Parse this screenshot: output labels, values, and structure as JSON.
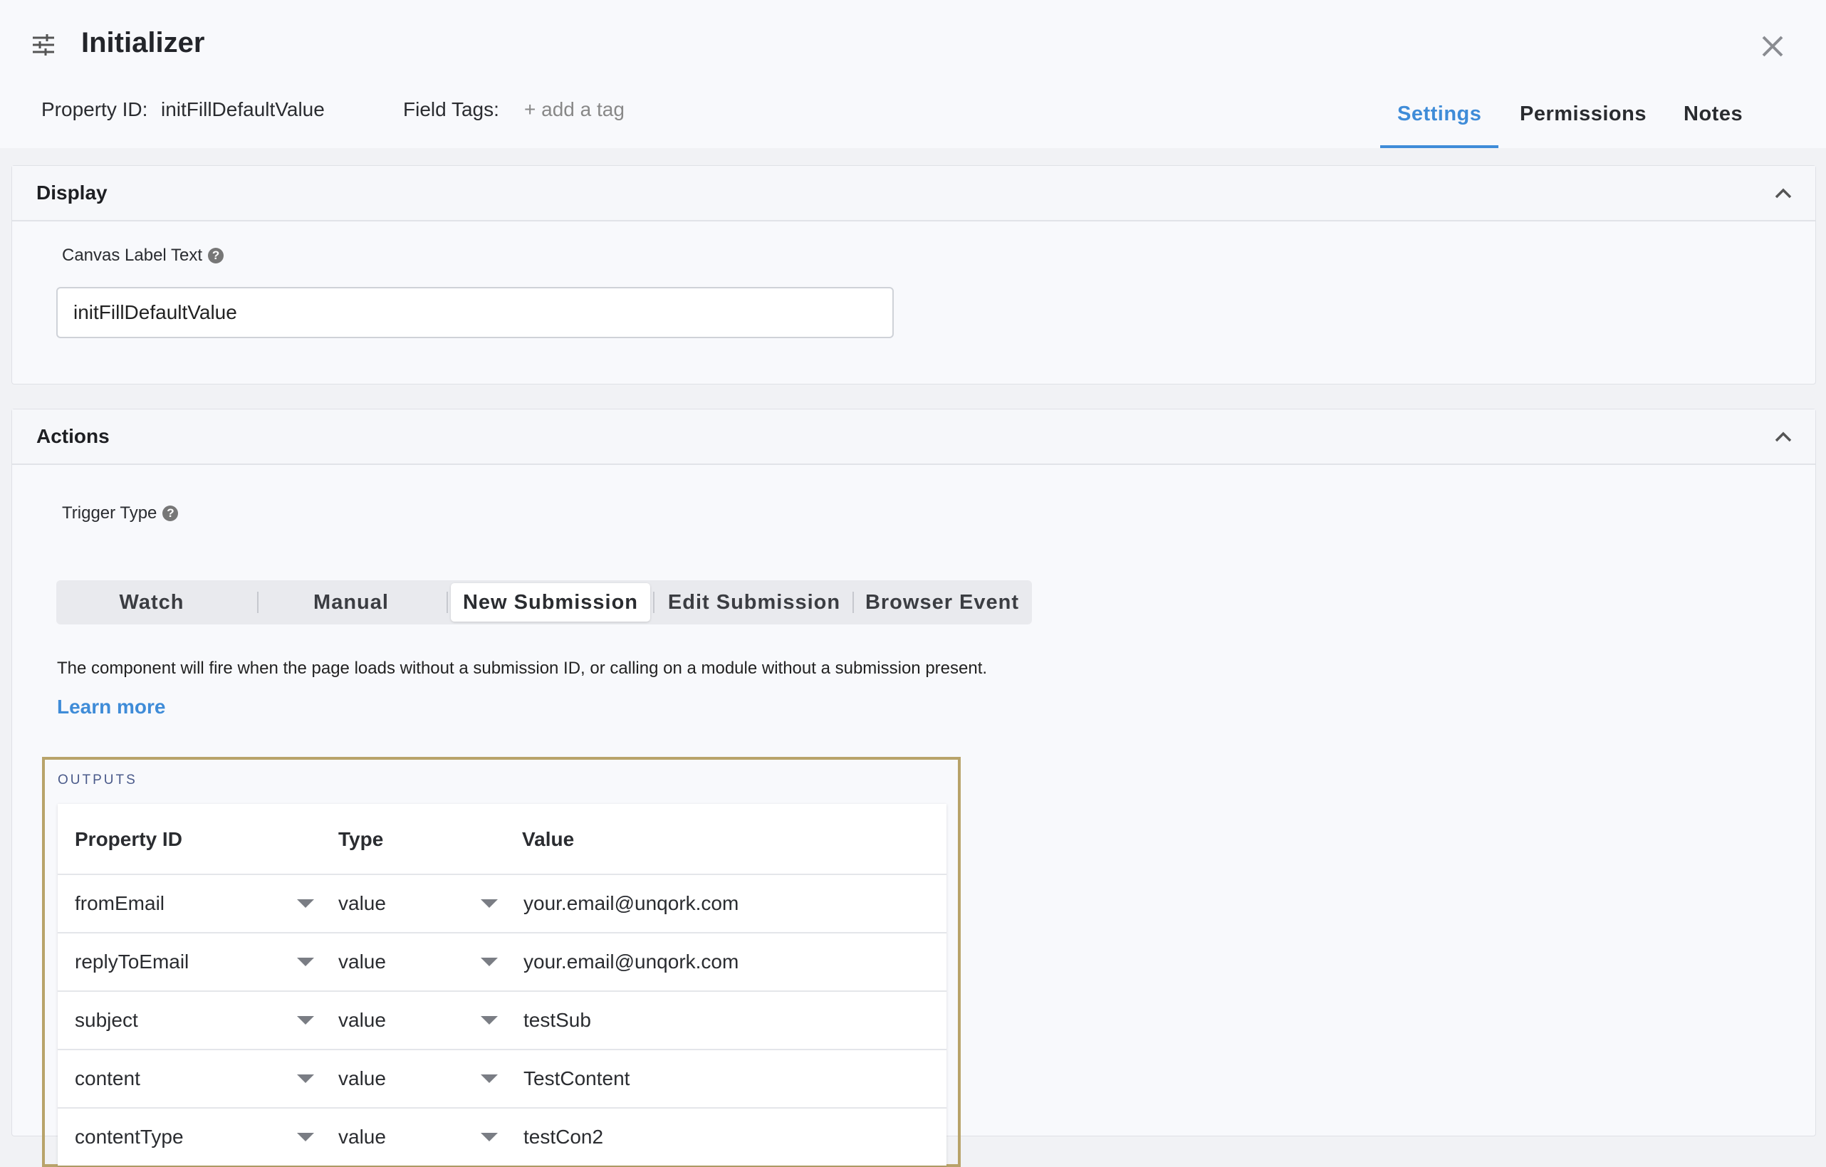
{
  "header": {
    "title": "Initializer",
    "property_id_label": "Property ID:",
    "property_id_value": "initFillDefaultValue",
    "field_tags_label": "Field Tags:",
    "add_tag_label": "+ add a tag",
    "tabs": [
      {
        "label": "Settings",
        "active": true
      },
      {
        "label": "Permissions",
        "active": false
      },
      {
        "label": "Notes",
        "active": false
      }
    ]
  },
  "display": {
    "section_title": "Display",
    "canvas_label_caption": "Canvas Label Text",
    "canvas_label_value": "initFillDefaultValue"
  },
  "actions": {
    "section_title": "Actions",
    "trigger_type_caption": "Trigger Type",
    "trigger_options": [
      "Watch",
      "Manual",
      "New Submission",
      "Edit Submission",
      "Browser Event"
    ],
    "selected_trigger": "New Submission",
    "description": "The component will fire when the page loads without a submission ID, or calling on a module without a submission present.",
    "learn_more": "Learn more",
    "outputs": {
      "label": "OUTPUTS",
      "columns": [
        "Property ID",
        "Type",
        "Value"
      ],
      "rows": [
        {
          "property_id": "fromEmail",
          "type": "value",
          "value": "your.email@unqork.com"
        },
        {
          "property_id": "replyToEmail",
          "type": "value",
          "value": "your.email@unqork.com"
        },
        {
          "property_id": "subject",
          "type": "value",
          "value": "testSub"
        },
        {
          "property_id": "content",
          "type": "value",
          "value": "TestContent"
        },
        {
          "property_id": "contentType",
          "type": "value",
          "value": "testCon2"
        }
      ]
    }
  },
  "colors": {
    "accent": "#3f8cd8",
    "highlight_border": "#b8a36a"
  },
  "icons": {
    "menu": "sliders-icon",
    "close": "close-icon",
    "collapse": "chevron-up-icon",
    "help": "help-circle-icon",
    "dropdown": "caret-down-icon"
  }
}
